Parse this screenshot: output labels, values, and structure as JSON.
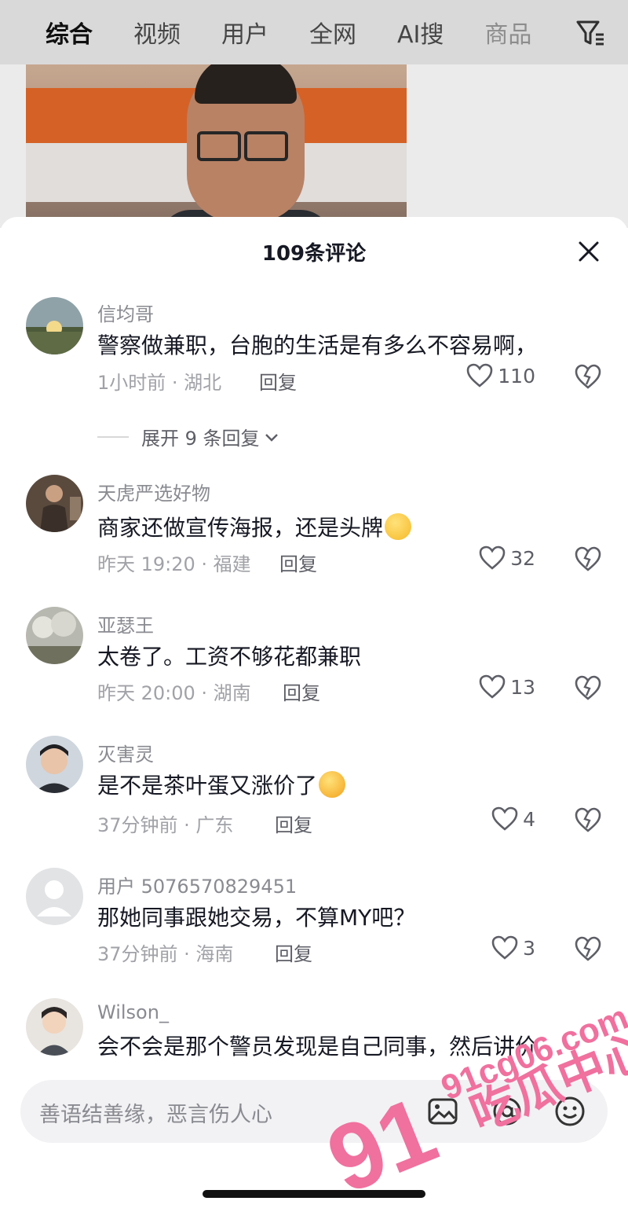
{
  "tabs": [
    {
      "label": "综合"
    },
    {
      "label": "视频"
    },
    {
      "label": "用户"
    },
    {
      "label": "全网"
    },
    {
      "label": "AI搜"
    },
    {
      "label": "商品"
    }
  ],
  "sheet": {
    "title": "109条评论"
  },
  "comments": [
    {
      "username": "信均哥",
      "text": "警察做兼职，台胞的生活是有多么不容易啊，",
      "time_loc": "1小时前 · 湖北",
      "reply_label": "回复",
      "likes": "110"
    },
    {
      "username": "天虎严选好物",
      "text": "商家还做宣传海报，还是头牌",
      "time_loc": "昨天 19:20 · 福建",
      "reply_label": "回复",
      "likes": "32"
    },
    {
      "username": "亚瑟王",
      "text": "太卷了。工资不够花都兼职",
      "time_loc": "昨天 20:00 · 湖南",
      "reply_label": "回复",
      "likes": "13"
    },
    {
      "username": "灭害灵",
      "text": "是不是茶叶蛋又涨价了",
      "time_loc": "37分钟前 · 广东",
      "reply_label": "回复",
      "likes": "4"
    },
    {
      "username": "用户 5076570829451",
      "text": "那她同事跟她交易，不算MY吧？",
      "time_loc": "37分钟前 · 海南",
      "reply_label": "回复",
      "likes": "3"
    },
    {
      "username": "Wilson_",
      "text": "会不会是那个警员发现是自己同事，然后讲价"
    }
  ],
  "expand_replies": "展开 9 条回复",
  "input": {
    "placeholder": "善语结善缘，恶言伤人心"
  },
  "watermark": {
    "number": "91",
    "domain": "91cg06.com",
    "brand": "吃瓜中心",
    "color": "#f0709e"
  }
}
